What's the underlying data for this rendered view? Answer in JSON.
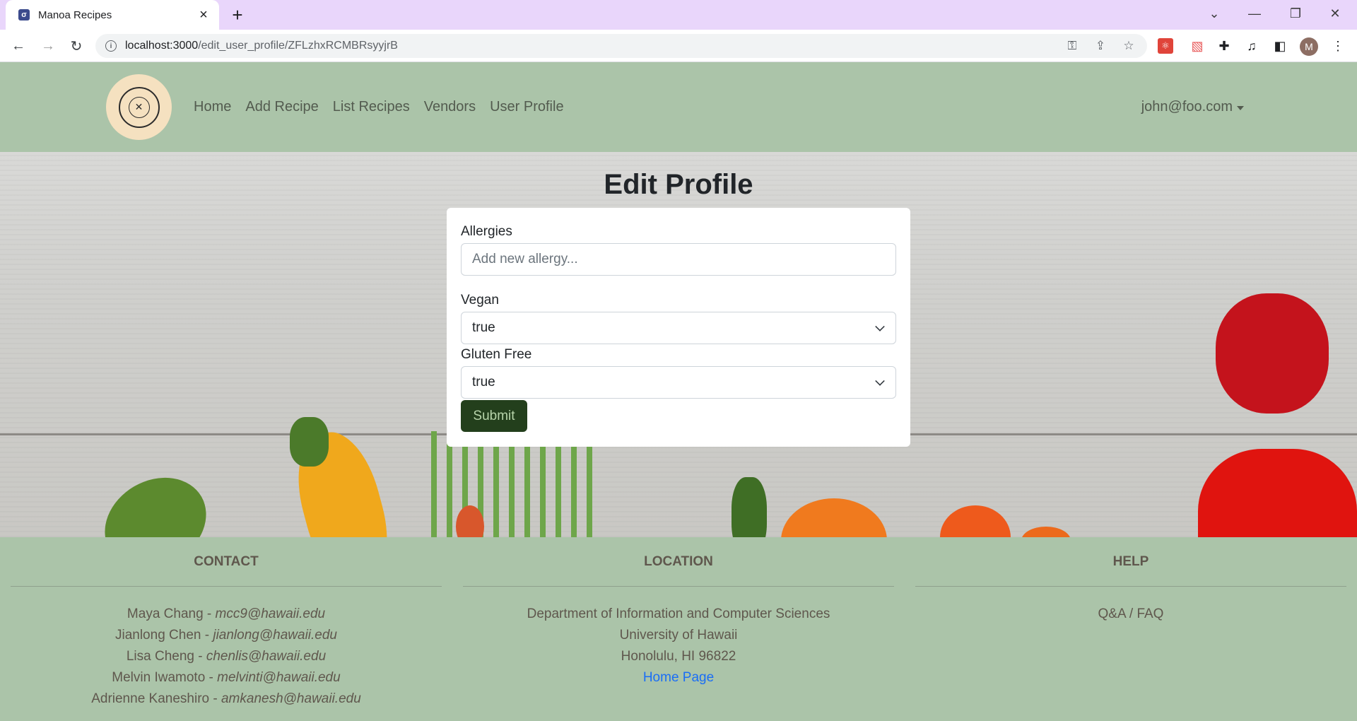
{
  "browser": {
    "tab_title": "Manoa Recipes",
    "url_host": "localhost:3000",
    "url_path": "/edit_user_profile/ZFLzhxRCMBRsyyjrB",
    "profile_initial": "M"
  },
  "navbar": {
    "links": [
      {
        "label": "Home"
      },
      {
        "label": "Add Recipe"
      },
      {
        "label": "List Recipes"
      },
      {
        "label": "Vendors"
      },
      {
        "label": "User Profile"
      }
    ],
    "user_email": "john@foo.com"
  },
  "page": {
    "title": "Edit Profile"
  },
  "form": {
    "allergies_label": "Allergies",
    "allergies_placeholder": "Add new allergy...",
    "allergies_value": "",
    "vegan_label": "Vegan",
    "vegan_value": "true",
    "gluten_label": "Gluten Free",
    "gluten_value": "true",
    "submit_label": "Submit"
  },
  "footer": {
    "contact": {
      "heading": "CONTACT",
      "people": [
        {
          "name": "Maya Chang - ",
          "email": "mcc9@hawaii.edu"
        },
        {
          "name": "Jianlong Chen - ",
          "email": "jianlong@hawaii.edu"
        },
        {
          "name": "Lisa Cheng - ",
          "email": "chenlis@hawaii.edu"
        },
        {
          "name": "Melvin Iwamoto - ",
          "email": "melvinti@hawaii.edu"
        },
        {
          "name": "Adrienne Kaneshiro - ",
          "email": "amkanesh@hawaii.edu"
        }
      ]
    },
    "location": {
      "heading": "LOCATION",
      "lines": [
        "Department of Information and Computer Sciences",
        "University of Hawaii",
        "Honolulu, HI 96822"
      ],
      "link_label": "Home Page"
    },
    "help": {
      "heading": "HELP",
      "link_label": "Q&A / FAQ"
    }
  },
  "colors": {
    "navbar_bg": "#abc4a9",
    "submit_bg": "#233f1c",
    "link_blue": "#1a6ef5"
  }
}
